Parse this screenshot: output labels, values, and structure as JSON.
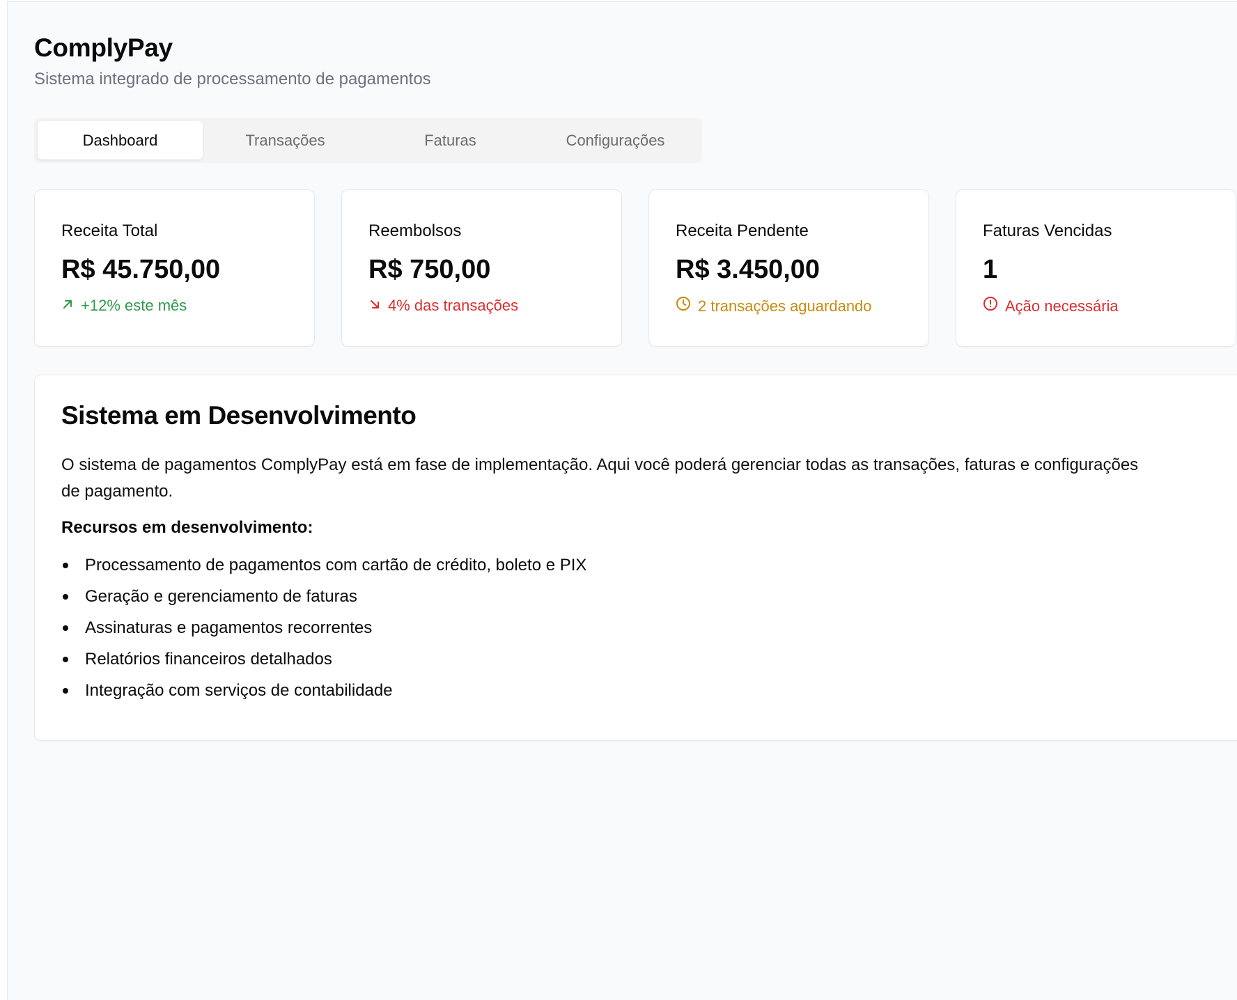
{
  "app": {
    "title": "ComplyPay",
    "subtitle": "Sistema integrado de processamento de pagamentos"
  },
  "tabs": [
    {
      "label": "Dashboard",
      "active": true
    },
    {
      "label": "Transações",
      "active": false
    },
    {
      "label": "Faturas",
      "active": false
    },
    {
      "label": "Configurações",
      "active": false
    }
  ],
  "cards": [
    {
      "label": "Receita Total",
      "value": "R$ 45.750,00",
      "note": "+12% este mês",
      "icon": "trend-up-icon",
      "color": "#2e9a4a"
    },
    {
      "label": "Reembolsos",
      "value": "R$ 750,00",
      "note": "4% das transações",
      "icon": "trend-down-icon",
      "color": "#d92f2f"
    },
    {
      "label": "Receita Pendente",
      "value": "R$ 3.450,00",
      "note": "2 transações aguardando",
      "icon": "clock-icon",
      "color": "#c98a0e"
    },
    {
      "label": "Faturas Vencidas",
      "value": "1",
      "note": "Ação necessária",
      "icon": "alert-circle-icon",
      "color": "#d92f2f"
    }
  ],
  "panel": {
    "title": "Sistema em Desenvolvimento",
    "description": "O sistema de pagamentos ComplyPay está em fase de implementação. Aqui você poderá gerenciar todas as transações, faturas e configurações de pagamento.",
    "subhead": "Recursos em desenvolvimento:",
    "features": [
      "Processamento de pagamentos com cartão de crédito, boleto e PIX",
      "Geração e gerenciamento de faturas",
      "Assinaturas e pagamentos recorrentes",
      "Relatórios financeiros detalhados",
      "Integração com serviços de contabilidade"
    ]
  }
}
